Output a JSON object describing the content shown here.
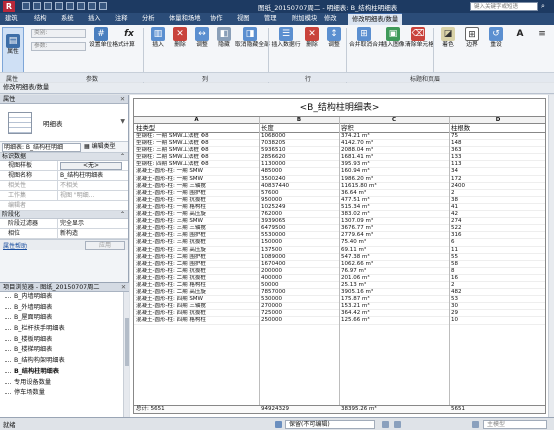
{
  "titlebar": {
    "app_logo": "R",
    "window_title": "图纸_20150707周二 - 明细表: B_结构柱明细表",
    "search_placeholder": "键入关键字或短语"
  },
  "ribbon_tabs": [
    {
      "label": "建筑"
    },
    {
      "label": "结构"
    },
    {
      "label": "系统"
    },
    {
      "label": "插入"
    },
    {
      "label": "注释"
    },
    {
      "label": "分析"
    },
    {
      "label": "体量和场地"
    },
    {
      "label": "协作"
    },
    {
      "label": "视图"
    },
    {
      "label": "管理"
    },
    {
      "label": "附加模块"
    },
    {
      "label": "修改"
    },
    {
      "label": "修改明细表/数量"
    }
  ],
  "ribbon": {
    "properties_btn": "属性",
    "field_category": "类别:",
    "field_parameter": "参数:",
    "buttons": [
      {
        "label": "设置单位格式"
      },
      {
        "label": "计算"
      },
      {
        "label": "插入"
      },
      {
        "label": "删除"
      },
      {
        "label": "调整"
      },
      {
        "label": "隐藏"
      },
      {
        "label": "取消隐藏全部"
      },
      {
        "label": "插入数据行"
      },
      {
        "label": "删除"
      },
      {
        "label": "调整"
      },
      {
        "label": "合并取消合并"
      },
      {
        "label": "插入图像"
      },
      {
        "label": "清除单元格"
      },
      {
        "label": "着色"
      },
      {
        "label": "边界"
      },
      {
        "label": "重设"
      }
    ],
    "group_labels": {
      "properties": "属性",
      "parameters": "参数",
      "columns": "列",
      "rows": "行",
      "titles": "标题和页眉"
    }
  },
  "options_bar": "修改明细表/数量",
  "properties_panel": {
    "title": "属性",
    "type_name": "明细表",
    "instance_dropdown": "明细表: B_结构柱明细",
    "edit_type": "编辑类型",
    "section_id": "标识数据",
    "rows_id": [
      {
        "key": "视图样板",
        "value": "<无>"
      },
      {
        "key": "视图名称",
        "value": "B_结构柱明细表"
      },
      {
        "key": "相关性",
        "value": "不相关"
      },
      {
        "key": "工作集",
        "value": "视图 \"明细..."
      },
      {
        "key": "编辑者",
        "value": ""
      }
    ],
    "section_phase": "阶段化",
    "rows_phase": [
      {
        "key": "阶段过滤器",
        "value": "完全显示"
      },
      {
        "key": "相位",
        "value": "新构造"
      }
    ],
    "help_link": "属性帮助",
    "apply_button": "应用"
  },
  "project_browser": {
    "title": "项目浏览器 - 图纸_20150707周二",
    "items": [
      {
        "label": "B_内墙明细表"
      },
      {
        "label": "B_外墙明细表"
      },
      {
        "label": "B_屋面明细表"
      },
      {
        "label": "B_栏杆扶手明细表"
      },
      {
        "label": "B_楼板明细表"
      },
      {
        "label": "B_楼梯明细表"
      },
      {
        "label": "B_结构构架明细表"
      },
      {
        "label": "B_结构柱明细表",
        "selected": true
      },
      {
        "label": "专用设备数量"
      },
      {
        "label": "停车场数量"
      }
    ]
  },
  "schedule": {
    "title": "<B_结构柱明细表>",
    "column_letters": [
      "A",
      "B",
      "C",
      "D"
    ],
    "headers": [
      "柱类型",
      "长度",
      "容积",
      "柱根数"
    ],
    "rows": [
      [
        "型钢柱: 一期 SMW工法桩 Φ8",
        "1068000",
        "374.21 m³",
        "75"
      ],
      [
        "型钢柱: 一期 SMW工法桩 Φ8",
        "7038205",
        "4142.70 m³",
        "148"
      ],
      [
        "型钢柱: 三期 SMW工法桩 Φ8",
        "5936510",
        "2088.04 m³",
        "363"
      ],
      [
        "型钢柱: 二期 SMW工法桩 Φ8",
        "2856620",
        "1681.41 m³",
        "133"
      ],
      [
        "型钢柱: 四期 SMW工法桩 Φ8",
        "1130000",
        "395.93 m³",
        "113"
      ],
      [
        "混凝土-圆形-柱: 一期 SMW",
        "485000",
        "160.94 m³",
        "34"
      ],
      [
        "混凝土-圆形-柱: 一期 SMW",
        "3500240",
        "1986.20 m³",
        "172"
      ],
      [
        "混凝土-圆形-柱: 一期 三轴搅",
        "40837440",
        "11615.80 m³",
        "2400"
      ],
      [
        "混凝土-圆形-柱: 一期 围护桩",
        "57600",
        "36.64 m³",
        "2"
      ],
      [
        "混凝土-圆形-柱: 一期 抗拔桩",
        "950000",
        "477.51 m³",
        "38"
      ],
      [
        "混凝土-圆形-柱: 一期 格构柱",
        "1025249",
        "515.34 m³",
        "41"
      ],
      [
        "混凝土-圆形-柱: 一期 高压旋",
        "762000",
        "383.02 m³",
        "42"
      ],
      [
        "混凝土-圆形-柱: 三期 SMW",
        "3939065",
        "1307.09 m³",
        "274"
      ],
      [
        "混凝土-圆形-柱: 三期 三轴搅",
        "6479500",
        "3676.77 m³",
        "522"
      ],
      [
        "混凝土-圆形-柱: 三期 围护桩",
        "5530000",
        "2779.64 m³",
        "316"
      ],
      [
        "混凝土-圆形-柱: 三期 抗拔桩",
        "150000",
        "75.40 m³",
        "6"
      ],
      [
        "混凝土-圆形-柱: 三期 高压旋",
        "137500",
        "69.11 m³",
        "11"
      ],
      [
        "混凝土-圆形-柱: 二期 围护桩",
        "1089000",
        "547.38 m³",
        "55"
      ],
      [
        "混凝土-圆形-柱: 二期 围护桩",
        "1670400",
        "1062.66 m³",
        "58"
      ],
      [
        "混凝土-圆形-柱: 二期 抗拔桩",
        "200000",
        "76.97 m³",
        "8"
      ],
      [
        "混凝土-圆形-柱: 二期 抗拔桩",
        "400000",
        "201.06 m³",
        "16"
      ],
      [
        "混凝土-圆形-柱: 二期 格构柱",
        "50000",
        "25.13 m³",
        "2"
      ],
      [
        "混凝土-圆形-柱: 二期 高压旋",
        "7857000",
        "3905.16 m³",
        "482"
      ],
      [
        "混凝土-圆形-柱: 四期 SMW",
        "530000",
        "175.87 m³",
        "53"
      ],
      [
        "混凝土-圆形-柱: 四期 三轴搅",
        "270000",
        "153.21 m³",
        "30"
      ],
      [
        "混凝土-圆形-柱: 四期 抗拔桩",
        "725000",
        "364.42 m³",
        "29"
      ],
      [
        "混凝土-圆形-柱: 四期 格构柱",
        "250000",
        "125.66 m³",
        "10"
      ]
    ],
    "totals": [
      "总计: 5651",
      "94924329",
      "38395.26 m³",
      "5651"
    ]
  },
  "statusbar": {
    "status": "就绪",
    "workset": "保留(不可编辑)",
    "model": "主模型"
  }
}
